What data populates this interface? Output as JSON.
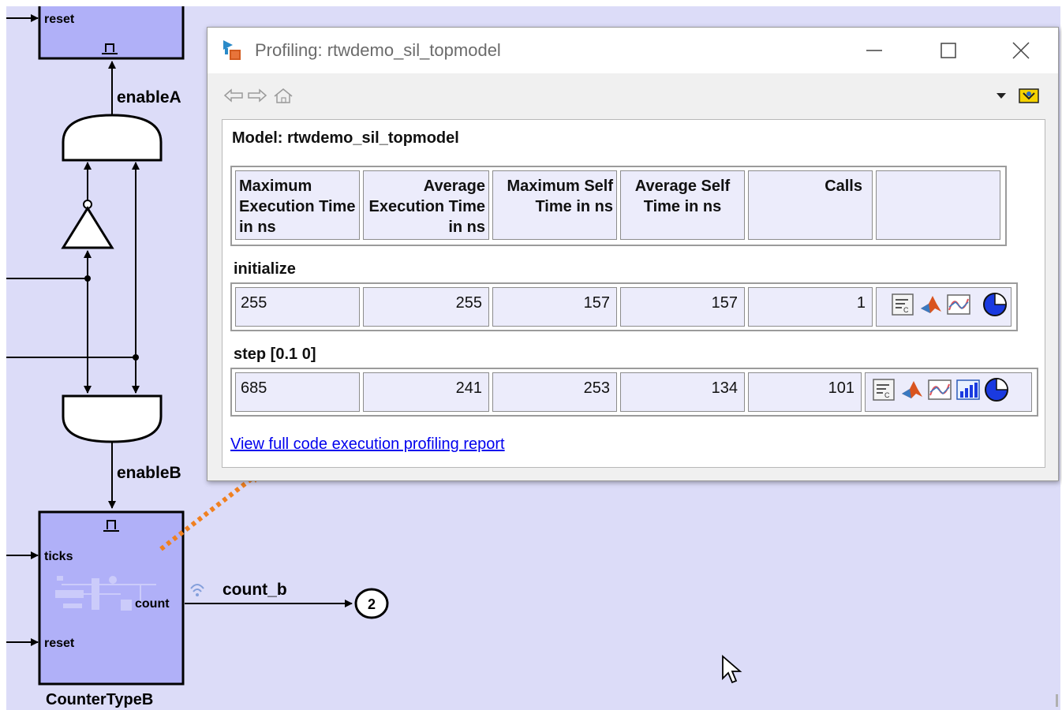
{
  "diagram": {
    "signals": {
      "reset_top": "reset",
      "enableA": "enableA",
      "enableB": "enableB",
      "ticks": "ticks",
      "count": "count",
      "reset_bottom": "reset",
      "count_b": "count_b"
    },
    "outport_number": "2",
    "block_name": "CounterTypeB"
  },
  "profiling_window": {
    "title": "Profiling: rtwdemo_sil_topmodel",
    "model_label": "Model: rtwdemo_sil_topmodel",
    "headers": [
      "Maximum Execution Time in ns",
      "Average Execution Time in ns",
      "Maximum Self Time in ns",
      "Average Self Time in ns",
      "Calls",
      ""
    ],
    "sections": [
      {
        "name": "initialize",
        "values": [
          "255",
          "255",
          "157",
          "157",
          "1"
        ],
        "actions": [
          "code-icon",
          "matlab-icon",
          "timeline-icon",
          "pie-chart-icon"
        ]
      },
      {
        "name": "step [0.1 0]",
        "values": [
          "685",
          "241",
          "253",
          "134",
          "101"
        ],
        "actions": [
          "code-icon",
          "matlab-icon",
          "timeline-icon",
          "bar-chart-icon",
          "pie-chart-icon"
        ]
      }
    ],
    "report_link": "View full code execution profiling report"
  },
  "colors": {
    "canvas": "#dcdcf8",
    "block_fill": "#b0b0f8",
    "cell_fill": "#ececfb",
    "link": "#0000ee",
    "callout": "#f08020"
  }
}
